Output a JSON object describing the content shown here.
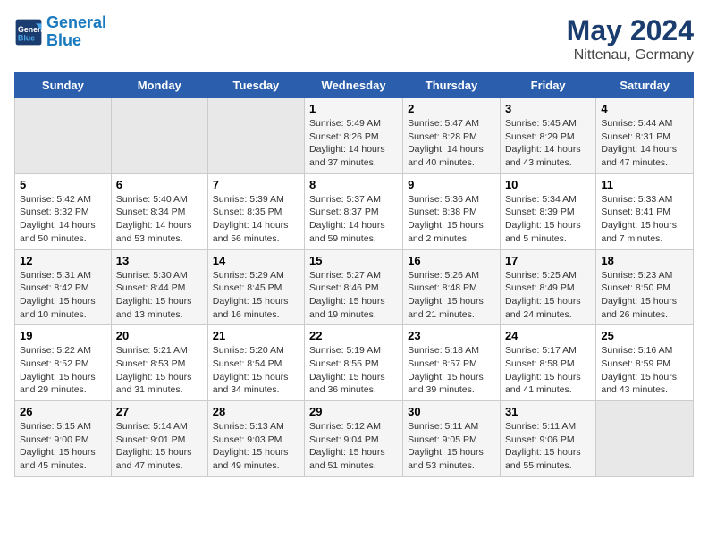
{
  "header": {
    "logo_line1": "General",
    "logo_line2": "Blue",
    "title": "May 2024",
    "subtitle": "Nittenau, Germany"
  },
  "weekdays": [
    "Sunday",
    "Monday",
    "Tuesday",
    "Wednesday",
    "Thursday",
    "Friday",
    "Saturday"
  ],
  "weeks": [
    [
      {
        "day": "",
        "info": ""
      },
      {
        "day": "",
        "info": ""
      },
      {
        "day": "",
        "info": ""
      },
      {
        "day": "1",
        "info": "Sunrise: 5:49 AM\nSunset: 8:26 PM\nDaylight: 14 hours\nand 37 minutes."
      },
      {
        "day": "2",
        "info": "Sunrise: 5:47 AM\nSunset: 8:28 PM\nDaylight: 14 hours\nand 40 minutes."
      },
      {
        "day": "3",
        "info": "Sunrise: 5:45 AM\nSunset: 8:29 PM\nDaylight: 14 hours\nand 43 minutes."
      },
      {
        "day": "4",
        "info": "Sunrise: 5:44 AM\nSunset: 8:31 PM\nDaylight: 14 hours\nand 47 minutes."
      }
    ],
    [
      {
        "day": "5",
        "info": "Sunrise: 5:42 AM\nSunset: 8:32 PM\nDaylight: 14 hours\nand 50 minutes."
      },
      {
        "day": "6",
        "info": "Sunrise: 5:40 AM\nSunset: 8:34 PM\nDaylight: 14 hours\nand 53 minutes."
      },
      {
        "day": "7",
        "info": "Sunrise: 5:39 AM\nSunset: 8:35 PM\nDaylight: 14 hours\nand 56 minutes."
      },
      {
        "day": "8",
        "info": "Sunrise: 5:37 AM\nSunset: 8:37 PM\nDaylight: 14 hours\nand 59 minutes."
      },
      {
        "day": "9",
        "info": "Sunrise: 5:36 AM\nSunset: 8:38 PM\nDaylight: 15 hours\nand 2 minutes."
      },
      {
        "day": "10",
        "info": "Sunrise: 5:34 AM\nSunset: 8:39 PM\nDaylight: 15 hours\nand 5 minutes."
      },
      {
        "day": "11",
        "info": "Sunrise: 5:33 AM\nSunset: 8:41 PM\nDaylight: 15 hours\nand 7 minutes."
      }
    ],
    [
      {
        "day": "12",
        "info": "Sunrise: 5:31 AM\nSunset: 8:42 PM\nDaylight: 15 hours\nand 10 minutes."
      },
      {
        "day": "13",
        "info": "Sunrise: 5:30 AM\nSunset: 8:44 PM\nDaylight: 15 hours\nand 13 minutes."
      },
      {
        "day": "14",
        "info": "Sunrise: 5:29 AM\nSunset: 8:45 PM\nDaylight: 15 hours\nand 16 minutes."
      },
      {
        "day": "15",
        "info": "Sunrise: 5:27 AM\nSunset: 8:46 PM\nDaylight: 15 hours\nand 19 minutes."
      },
      {
        "day": "16",
        "info": "Sunrise: 5:26 AM\nSunset: 8:48 PM\nDaylight: 15 hours\nand 21 minutes."
      },
      {
        "day": "17",
        "info": "Sunrise: 5:25 AM\nSunset: 8:49 PM\nDaylight: 15 hours\nand 24 minutes."
      },
      {
        "day": "18",
        "info": "Sunrise: 5:23 AM\nSunset: 8:50 PM\nDaylight: 15 hours\nand 26 minutes."
      }
    ],
    [
      {
        "day": "19",
        "info": "Sunrise: 5:22 AM\nSunset: 8:52 PM\nDaylight: 15 hours\nand 29 minutes."
      },
      {
        "day": "20",
        "info": "Sunrise: 5:21 AM\nSunset: 8:53 PM\nDaylight: 15 hours\nand 31 minutes."
      },
      {
        "day": "21",
        "info": "Sunrise: 5:20 AM\nSunset: 8:54 PM\nDaylight: 15 hours\nand 34 minutes."
      },
      {
        "day": "22",
        "info": "Sunrise: 5:19 AM\nSunset: 8:55 PM\nDaylight: 15 hours\nand 36 minutes."
      },
      {
        "day": "23",
        "info": "Sunrise: 5:18 AM\nSunset: 8:57 PM\nDaylight: 15 hours\nand 39 minutes."
      },
      {
        "day": "24",
        "info": "Sunrise: 5:17 AM\nSunset: 8:58 PM\nDaylight: 15 hours\nand 41 minutes."
      },
      {
        "day": "25",
        "info": "Sunrise: 5:16 AM\nSunset: 8:59 PM\nDaylight: 15 hours\nand 43 minutes."
      }
    ],
    [
      {
        "day": "26",
        "info": "Sunrise: 5:15 AM\nSunset: 9:00 PM\nDaylight: 15 hours\nand 45 minutes."
      },
      {
        "day": "27",
        "info": "Sunrise: 5:14 AM\nSunset: 9:01 PM\nDaylight: 15 hours\nand 47 minutes."
      },
      {
        "day": "28",
        "info": "Sunrise: 5:13 AM\nSunset: 9:03 PM\nDaylight: 15 hours\nand 49 minutes."
      },
      {
        "day": "29",
        "info": "Sunrise: 5:12 AM\nSunset: 9:04 PM\nDaylight: 15 hours\nand 51 minutes."
      },
      {
        "day": "30",
        "info": "Sunrise: 5:11 AM\nSunset: 9:05 PM\nDaylight: 15 hours\nand 53 minutes."
      },
      {
        "day": "31",
        "info": "Sunrise: 5:11 AM\nSunset: 9:06 PM\nDaylight: 15 hours\nand 55 minutes."
      },
      {
        "day": "",
        "info": ""
      }
    ]
  ]
}
